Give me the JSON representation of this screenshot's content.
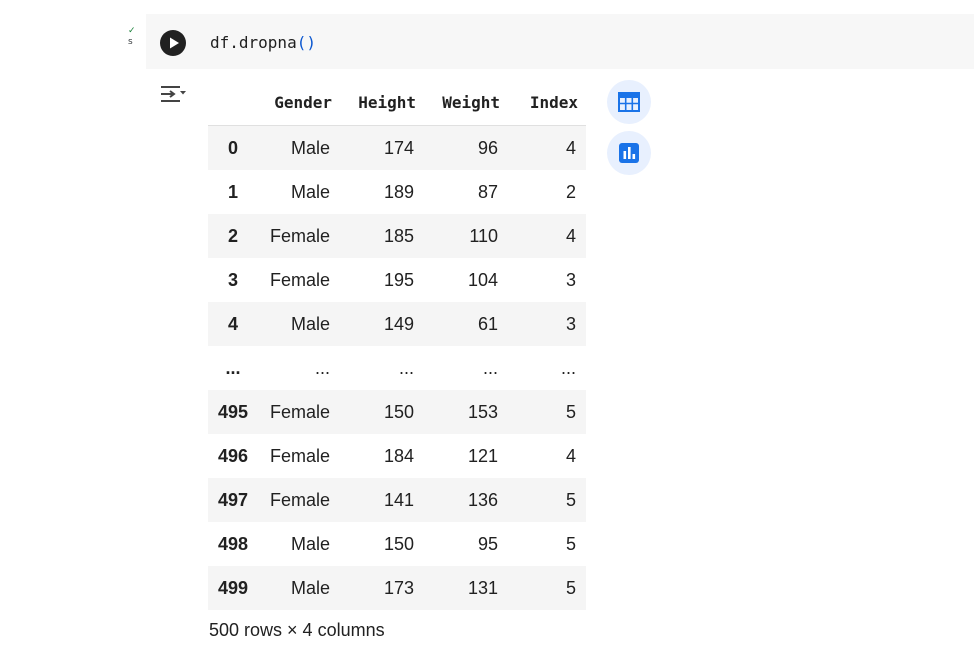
{
  "cell": {
    "code_main": "df.dropna",
    "code_paren": "()",
    "gutter_text": "s"
  },
  "icons": {
    "run": "play-circle-icon",
    "output_toggle": "output-collapse-icon",
    "table_view": "table-grid-icon",
    "suggest_charts": "bar-chart-icon"
  },
  "colors": {
    "code_bg": "#f7f7f7",
    "accent_blue": "#1a73e8",
    "side_button_bg": "#e8f0fe",
    "row_stripe": "#f5f5f5"
  },
  "dataframe": {
    "columns": [
      "",
      "Gender",
      "Height",
      "Weight",
      "Index"
    ],
    "rows": [
      [
        "0",
        "Male",
        "174",
        "96",
        "4"
      ],
      [
        "1",
        "Male",
        "189",
        "87",
        "2"
      ],
      [
        "2",
        "Female",
        "185",
        "110",
        "4"
      ],
      [
        "3",
        "Female",
        "195",
        "104",
        "3"
      ],
      [
        "4",
        "Male",
        "149",
        "61",
        "3"
      ],
      [
        "...",
        "...",
        "...",
        "...",
        "..."
      ],
      [
        "495",
        "Female",
        "150",
        "153",
        "5"
      ],
      [
        "496",
        "Female",
        "184",
        "121",
        "4"
      ],
      [
        "497",
        "Female",
        "141",
        "136",
        "5"
      ],
      [
        "498",
        "Male",
        "150",
        "95",
        "5"
      ],
      [
        "499",
        "Male",
        "173",
        "131",
        "5"
      ]
    ],
    "footer": "500 rows × 4 columns"
  }
}
